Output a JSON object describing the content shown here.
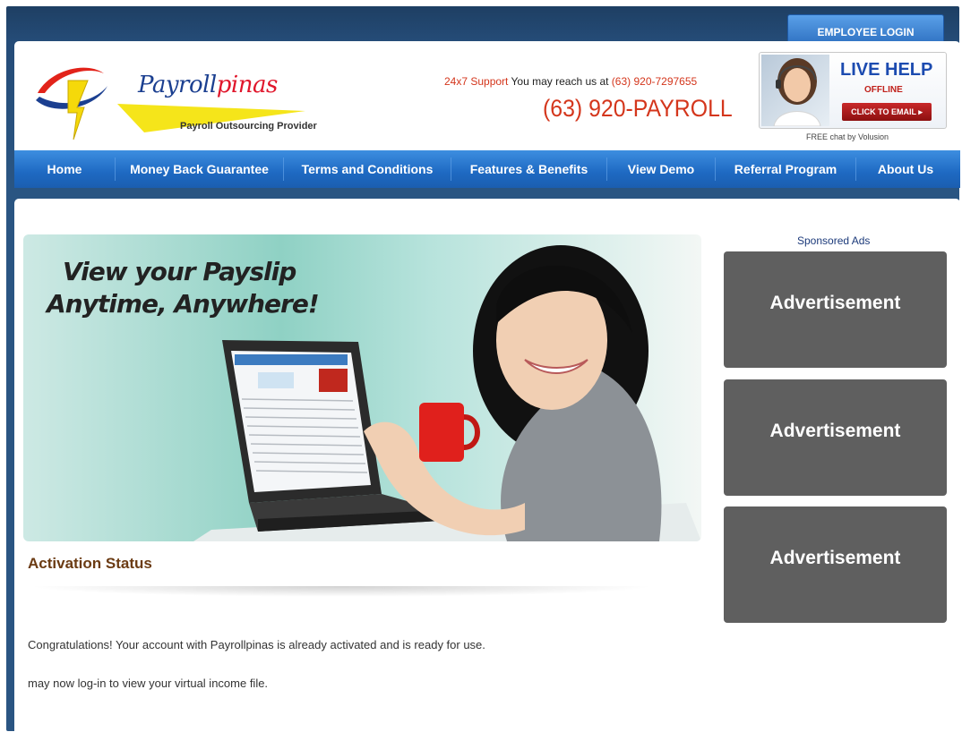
{
  "header": {
    "employee_login": "EMPLOYEE LOGIN",
    "logo": {
      "name_part1": "Payroll",
      "name_part2": "pinas",
      "tagline": "Payroll Outsourcing Provider"
    },
    "support": {
      "prefix": "24x7 Support",
      "middle": " You may reach us at ",
      "phone": "(63) 920-7297655"
    },
    "phone_big": "(63) 920-PAYROLL",
    "live_help": {
      "title": "LIVE HELP",
      "status": "OFFLINE",
      "button": "CLICK TO EMAIL ▸",
      "footer": "FREE chat by Volusion"
    }
  },
  "nav": {
    "items": [
      {
        "label": "Home"
      },
      {
        "label": "Money Back Guarantee"
      },
      {
        "label": "Terms and Conditions"
      },
      {
        "label": "Features & Benefits"
      },
      {
        "label": "View Demo"
      },
      {
        "label": "Referral Program"
      },
      {
        "label": "About Us"
      }
    ]
  },
  "banner": {
    "line1": "View your Payslip",
    "line2": "Anytime, Anywhere!"
  },
  "content": {
    "title": "Activation Status",
    "message1": "Congratulations! Your account with Payrollpinas is already activated and is ready for use.",
    "message2": "may now log-in to view your virtual income file."
  },
  "sidebar": {
    "sponsored_label": "Sponsored Ads",
    "ads": [
      {
        "label": "Advertisement"
      },
      {
        "label": "Advertisement"
      },
      {
        "label": "Advertisement"
      }
    ]
  },
  "colors": {
    "nav_blue": "#1e69c2",
    "frame_navy": "#254c78",
    "phone_red": "#d4361c",
    "title_brown": "#6b3b13",
    "ad_gray": "#5f5f5f"
  }
}
